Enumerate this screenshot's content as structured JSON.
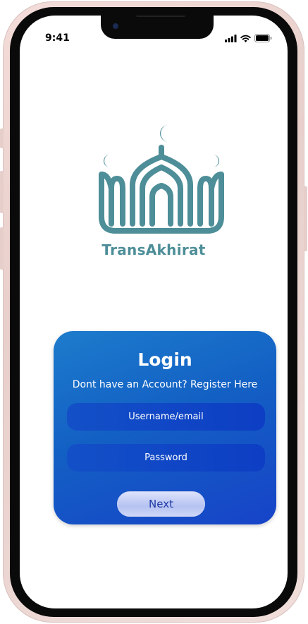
{
  "status_bar": {
    "time": "9:41",
    "icons": [
      "signal-icon",
      "wifi-icon",
      "battery-icon"
    ]
  },
  "brand": {
    "name": "TransAkhirat",
    "logo_icon": "mosque-icon",
    "color": "#4d8e98"
  },
  "login": {
    "title": "Login",
    "register_text": "Dont have an Account? Register Here",
    "username_placeholder": "Username/email",
    "password_placeholder": "Password",
    "next_label": "Next"
  },
  "colors": {
    "card_top": "#1d7ccc",
    "card_bottom": "#1743c8",
    "field": "#0d3ec4",
    "button_text": "#1f3aa4"
  }
}
